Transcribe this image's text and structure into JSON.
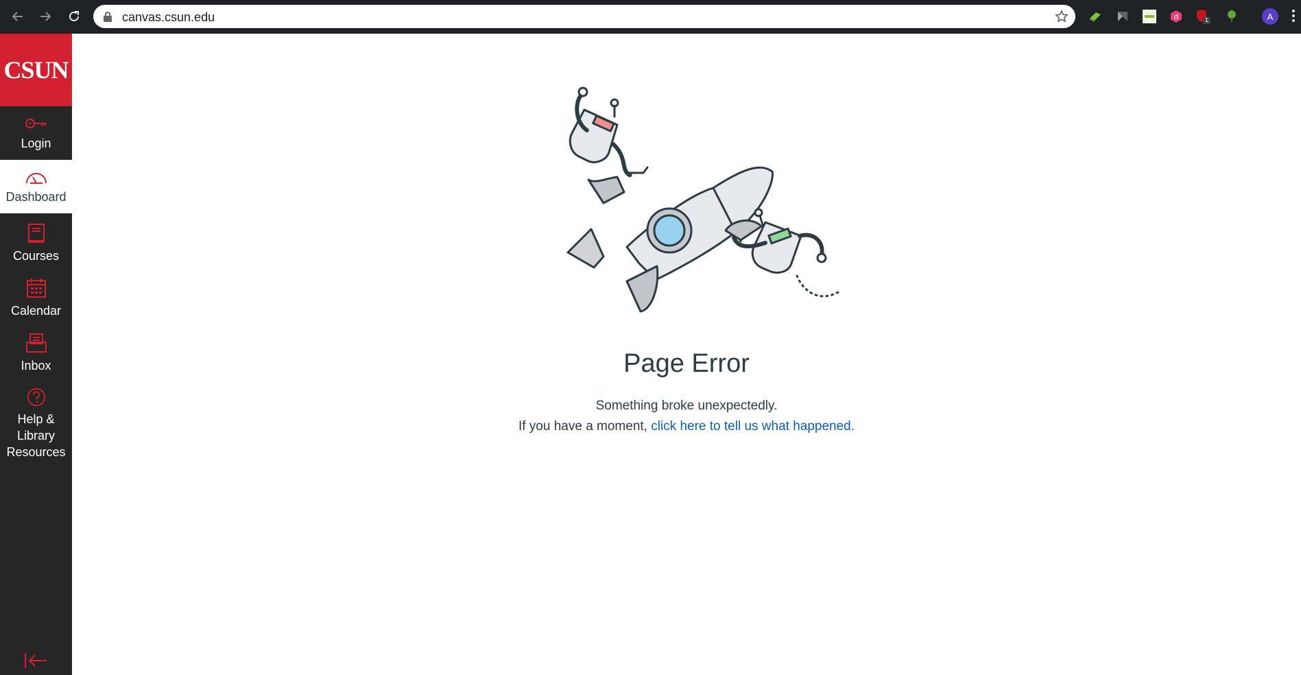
{
  "browser": {
    "url": "canvas.csun.edu",
    "profile_initial": "A",
    "extension_badge": "1"
  },
  "nav": {
    "logo_text": "CSUN",
    "items": [
      {
        "label": "Login",
        "icon": "key-icon"
      },
      {
        "label": "Dashboard",
        "icon": "dashboard-gauge-icon"
      },
      {
        "label": "Courses",
        "icon": "courses-book-icon"
      },
      {
        "label": "Calendar",
        "icon": "calendar-icon"
      },
      {
        "label": "Inbox",
        "icon": "inbox-icon"
      },
      {
        "label": "Help & Library Resources",
        "icon": "help-question-icon"
      }
    ],
    "active": "Dashboard",
    "accent": "#d22030"
  },
  "error": {
    "title": "Page Error",
    "line1": "Something broke unexpectedly.",
    "line2_prefix": "If you have a moment, ",
    "link_text": "click here to tell us what happened",
    "line2_suffix": "."
  }
}
